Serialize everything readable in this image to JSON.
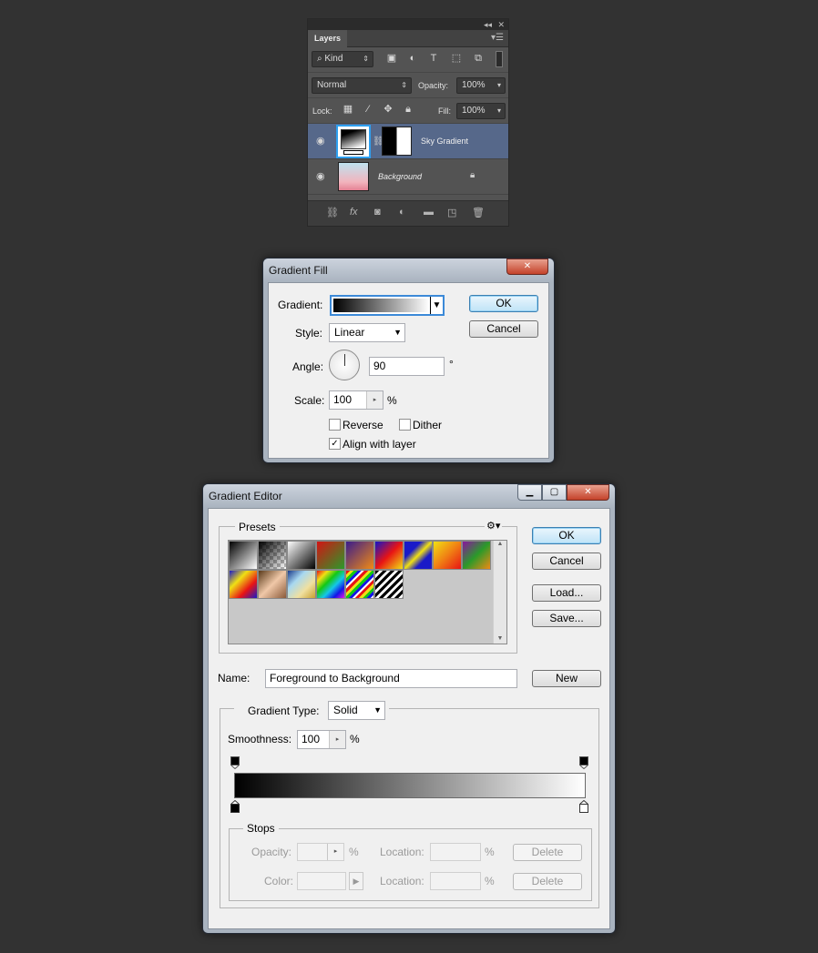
{
  "layers_panel": {
    "tab": "Layers",
    "filter_kind": "Kind",
    "blend_mode": "Normal",
    "opacity_label": "Opacity:",
    "opacity_value": "100%",
    "lock_label": "Lock:",
    "fill_label": "Fill:",
    "fill_value": "100%",
    "layers": [
      {
        "name": "Sky Gradient",
        "selected": true
      },
      {
        "name": "Background",
        "locked": true
      }
    ],
    "bottom_fx": "fx"
  },
  "gradient_fill": {
    "title": "Gradient Fill",
    "gradient_label": "Gradient:",
    "style_label": "Style:",
    "style_value": "Linear",
    "angle_label": "Angle:",
    "angle_value": "90",
    "angle_unit": "°",
    "scale_label": "Scale:",
    "scale_value": "100",
    "scale_unit": "%",
    "reverse": "Reverse",
    "dither": "Dither",
    "align": "Align with layer",
    "ok": "OK",
    "cancel": "Cancel"
  },
  "gradient_editor": {
    "title": "Gradient Editor",
    "presets_label": "Presets",
    "ok": "OK",
    "cancel": "Cancel",
    "load": "Load...",
    "save": "Save...",
    "name_label": "Name:",
    "name_value": "Foreground to Background",
    "new": "New",
    "gradient_type_label": "Gradient Type:",
    "gradient_type_value": "Solid",
    "smoothness_label": "Smoothness:",
    "smoothness_value": "100",
    "smoothness_unit": "%",
    "stops_label": "Stops",
    "opacity_label": "Opacity:",
    "opacity_unit": "%",
    "color_label": "Color:",
    "location_label": "Location:",
    "location_unit": "%",
    "delete": "Delete"
  },
  "colors": {
    "dark_bg": "#323232",
    "panel": "#535353",
    "selection": "#56688a",
    "focus": "#3c7fb1"
  }
}
